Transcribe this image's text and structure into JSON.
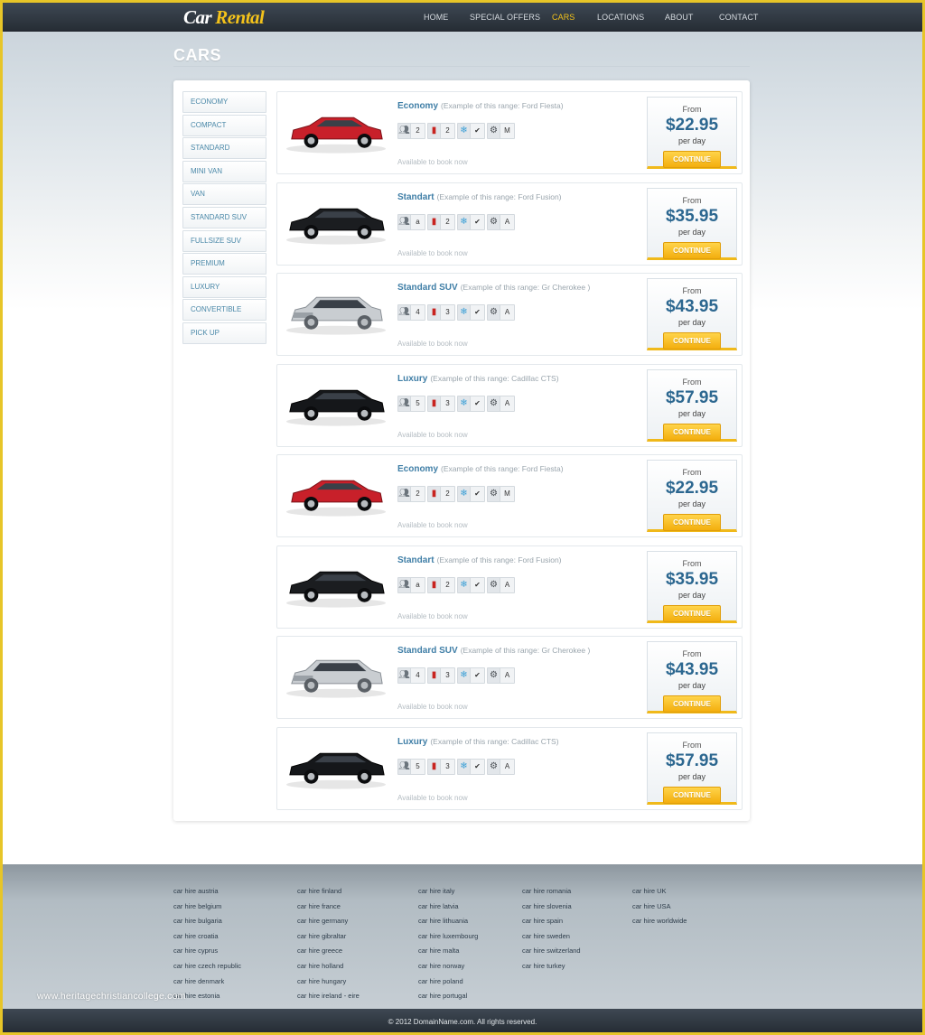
{
  "brand": {
    "word1": "Car",
    "word2": "Rental"
  },
  "nav": [
    {
      "label": "HOME",
      "active": false
    },
    {
      "label": "SPECIAL OFFERS",
      "active": false
    },
    {
      "label": "CARS",
      "active": true
    },
    {
      "label": "LOCATIONS",
      "active": false
    },
    {
      "label": "ABOUT",
      "active": false
    },
    {
      "label": "CONTACT",
      "active": false
    }
  ],
  "page_title": "CARS",
  "sidebar": {
    "items": [
      "ECONOMY",
      "COMPACT",
      "STANDARD",
      "MINI VAN",
      "VAN",
      "STANDARD SUV",
      "FULLSIZE SUV",
      "PREMIUM",
      "LUXURY",
      "CONVERTIBLE",
      "PICK UP"
    ]
  },
  "labels": {
    "from": "From",
    "per_day": "per day",
    "continue": "CONTINUE",
    "available": "Available to book now"
  },
  "cars": [
    {
      "name": "Economy",
      "example": "(Example of this range: Ford Fiesta)",
      "car": "red-hatchback",
      "passengers": "2",
      "bags": "2",
      "ac": "✔",
      "transmission": "M",
      "price": "$22.95"
    },
    {
      "name": "Standart",
      "example": "(Example of this range: Ford Fusion)",
      "car": "black-sedan",
      "passengers": "a",
      "bags": "2",
      "ac": "✔",
      "transmission": "A",
      "price": "$35.95"
    },
    {
      "name": "Standard SUV",
      "example": "(Example of this range: Gr Cherokee )",
      "car": "silver-suv",
      "passengers": "4",
      "bags": "3",
      "ac": "✔",
      "transmission": "A",
      "price": "$43.95"
    },
    {
      "name": "Luxury",
      "example": "(Example of this range: Cadillac CTS)",
      "car": "black-luxury-sedan",
      "passengers": "5",
      "bags": "3",
      "ac": "✔",
      "transmission": "A",
      "price": "$57.95"
    },
    {
      "name": "Economy",
      "example": "(Example of this range: Ford Fiesta)",
      "car": "red-hatchback",
      "passengers": "2",
      "bags": "2",
      "ac": "✔",
      "transmission": "M",
      "price": "$22.95"
    },
    {
      "name": "Standart",
      "example": "(Example of this range: Ford Fusion)",
      "car": "black-sedan",
      "passengers": "a",
      "bags": "2",
      "ac": "✔",
      "transmission": "A",
      "price": "$35.95"
    },
    {
      "name": "Standard SUV",
      "example": "(Example of this range: Gr Cherokee )",
      "car": "silver-suv",
      "passengers": "4",
      "bags": "3",
      "ac": "✔",
      "transmission": "A",
      "price": "$43.95"
    },
    {
      "name": "Luxury",
      "example": "(Example of this range: Cadillac CTS)",
      "car": "black-luxury-sedan",
      "passengers": "5",
      "bags": "3",
      "ac": "✔",
      "transmission": "A",
      "price": "$57.95"
    }
  ],
  "colors": {
    "red-hatchback": "#c8202a",
    "black-sedan": "#1b1d20",
    "silver-suv": "#c9cdd1",
    "black-luxury-sedan": "#15171a",
    "accent": "#f3c21b",
    "link": "#3f7ea6"
  },
  "icons": {
    "passengers": "person-icon",
    "bags": "luggage-icon",
    "ac": "snowflake-icon",
    "transmission": "gear-seat-icon"
  },
  "footer": {
    "columns": [
      [
        "car hire austria",
        "car hire belgium",
        "car hire bulgaria",
        "car hire croatia",
        "car hire cyprus",
        "car hire czech republic",
        "car hire denmark",
        "car hire estonia"
      ],
      [
        "car hire finland",
        "car hire france",
        "car hire germany",
        "car hire gibraltar",
        "car hire greece",
        "car hire holland",
        "car hire hungary",
        "car hire ireland - eire"
      ],
      [
        "car hire italy",
        "car hire latvia",
        "car hire lithuania",
        "car hire luxembourg",
        "car hire malta",
        "car hire norway",
        "car hire poland",
        "car hire portugal"
      ],
      [
        "car hire romania",
        "car hire slovenia",
        "car hire spain",
        "car hire sweden",
        "car hire switzerland",
        "car hire turkey"
      ],
      [
        "car hire UK",
        "car hire USA",
        "car hire worldwide"
      ]
    ],
    "watermark": "www.heritagechristiancollege.com",
    "copyright": "© 2012 DomainName.com. All rights reserved."
  }
}
